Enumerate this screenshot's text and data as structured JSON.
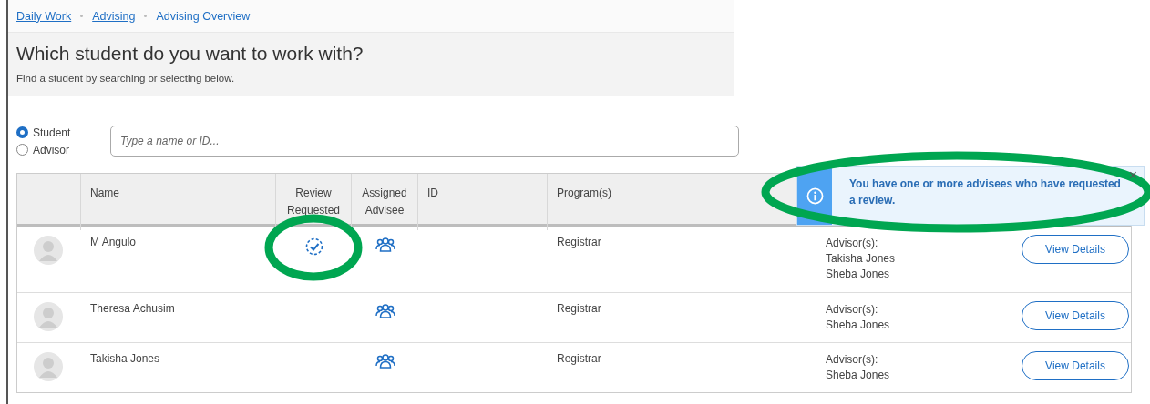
{
  "breadcrumb": [
    {
      "label": "Daily Work",
      "link": true
    },
    {
      "label": "Advising",
      "link": true
    },
    {
      "label": "Advising Overview",
      "link": false
    }
  ],
  "heading": {
    "title": "Which student do you want to work with?",
    "subtitle": "Find a student by searching or selecting below."
  },
  "search_mode": [
    {
      "label": "Student",
      "selected": true
    },
    {
      "label": "Advisor",
      "selected": false
    }
  ],
  "search": {
    "placeholder": "Type a name or ID..."
  },
  "table": {
    "columns": [
      "Name",
      "Review Requested",
      "Assigned Advisee",
      "ID",
      "Program(s)"
    ],
    "rows": [
      {
        "name": "M Angulo",
        "review_requested": true,
        "review_highlighted": true,
        "assigned_advisee": true,
        "program": "Registrar",
        "advisors_label": "Advisor(s):",
        "advisors": [
          "Takisha Jones",
          "Sheba Jones"
        ],
        "button": "View Details"
      },
      {
        "name": "Theresa Achusim",
        "review_requested": false,
        "review_highlighted": false,
        "assigned_advisee": true,
        "program": "Registrar",
        "advisors_label": "Advisor(s):",
        "advisors": [
          "Sheba Jones"
        ],
        "button": "View Details"
      },
      {
        "name": "Takisha Jones",
        "review_requested": false,
        "review_highlighted": false,
        "assigned_advisee": true,
        "program": "Registrar",
        "advisors_label": "Advisor(s):",
        "advisors": [
          "Sheba Jones"
        ],
        "button": "View Details"
      }
    ]
  },
  "notice": {
    "message": "You have one or more advisees who have requested a review.",
    "close": "×",
    "highlighted": true
  }
}
